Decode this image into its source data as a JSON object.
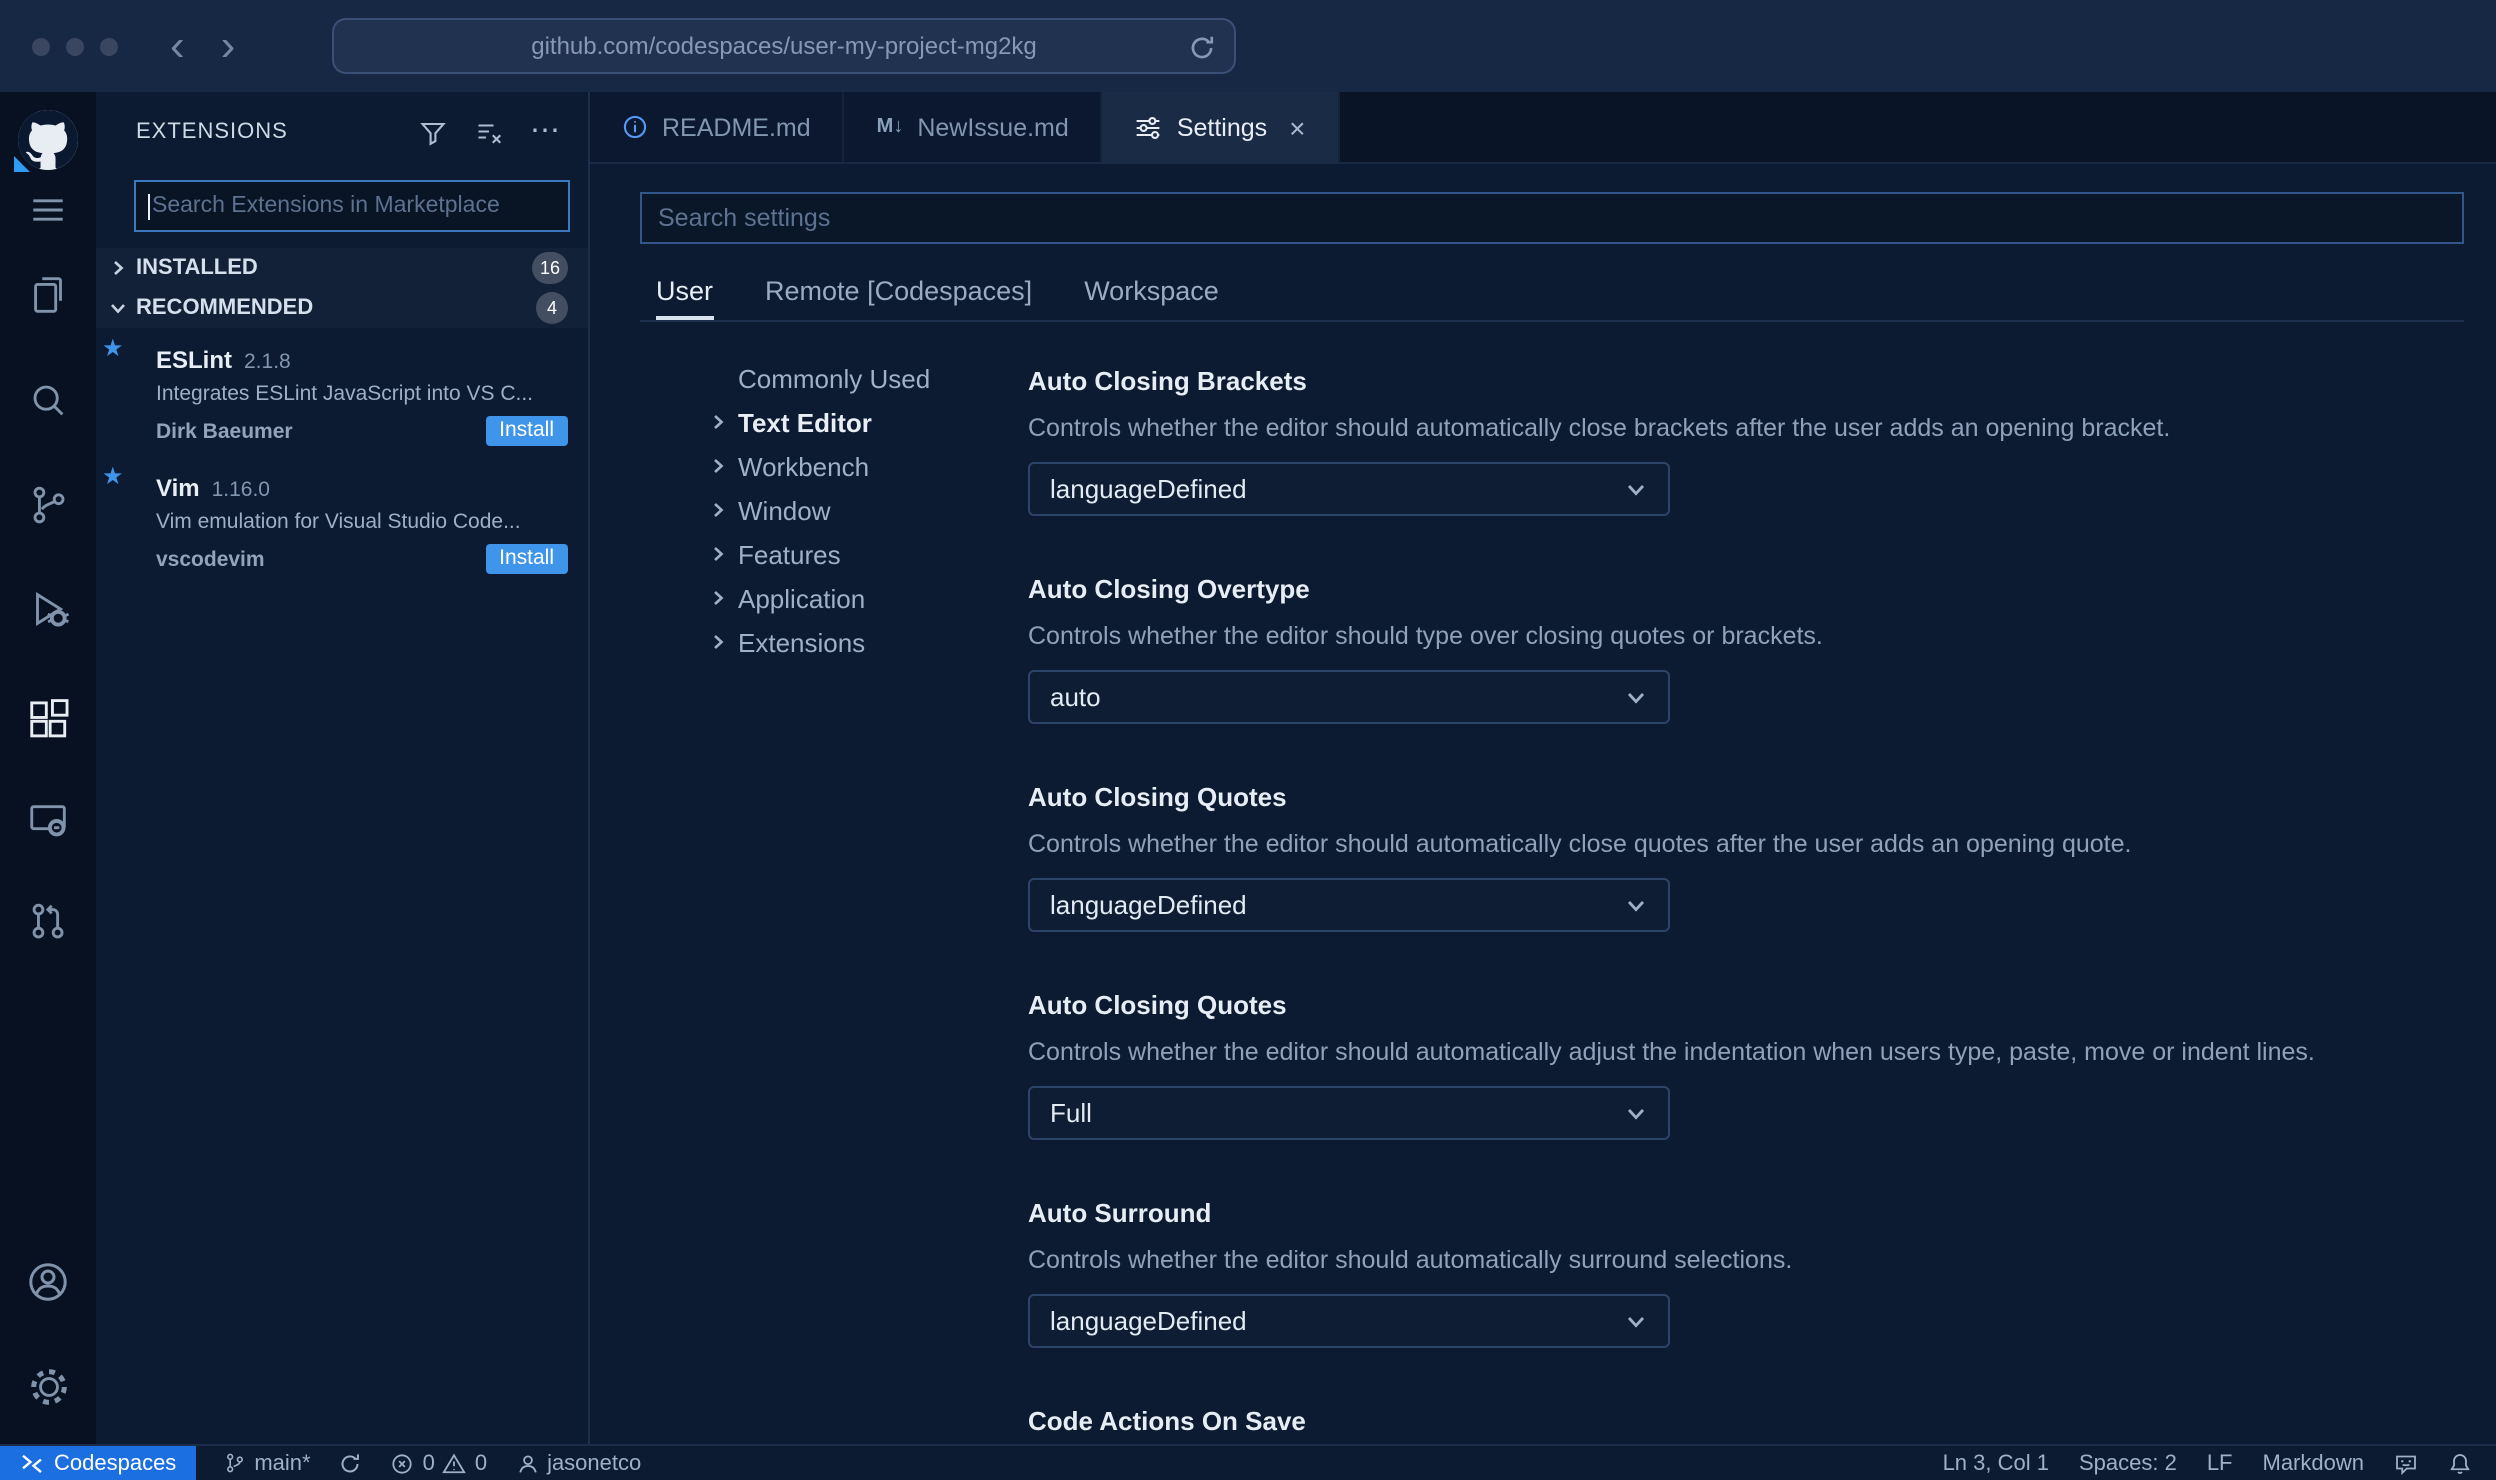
{
  "browser": {
    "url": "github.com/codespaces/user-my-project-mg2kg"
  },
  "glyphs": {
    "back": "‹",
    "forward": "›",
    "ellipsis": "⋯",
    "close": "×",
    "markdown_icon": "M↓",
    "star": "★"
  },
  "sidebar": {
    "title": "EXTENSIONS",
    "search_placeholder": "Search Extensions in Marketplace",
    "sections": [
      {
        "label": "INSTALLED",
        "count": "16"
      },
      {
        "label": "RECOMMENDED",
        "count": "4"
      }
    ],
    "extensions": [
      {
        "name": "ESLint",
        "version": "2.1.8",
        "description": "Integrates ESLint JavaScript into VS C...",
        "publisher": "Dirk Baeumer",
        "action": "Install"
      },
      {
        "name": "Vim",
        "version": "1.16.0",
        "description": "Vim emulation for Visual Studio Code...",
        "publisher": "vscodevim",
        "action": "Install"
      }
    ]
  },
  "editor": {
    "tabs": [
      {
        "label": "README.md"
      },
      {
        "label": "NewIssue.md"
      },
      {
        "label": "Settings"
      }
    ]
  },
  "settings": {
    "search_placeholder": "Search settings",
    "scopes": [
      "User",
      "Remote [Codespaces]",
      "Workspace"
    ],
    "toc": [
      "Commonly Used",
      "Text Editor",
      "Workbench",
      "Window",
      "Features",
      "Application",
      "Extensions"
    ],
    "items": [
      {
        "title": "Auto Closing Brackets",
        "description": "Controls whether the editor should automatically close brackets after the user adds an opening bracket.",
        "value": "languageDefined"
      },
      {
        "title": "Auto Closing Overtype",
        "description": "Controls whether the editor should type over closing quotes or brackets.",
        "value": "auto"
      },
      {
        "title": "Auto Closing Quotes",
        "description": "Controls whether the editor should automatically close quotes after the user adds an opening quote.",
        "value": "languageDefined"
      },
      {
        "title": "Auto Closing Quotes",
        "description": "Controls whether the editor should automatically adjust the indentation when users type, paste, move or indent lines.",
        "value": "Full"
      },
      {
        "title": "Auto Surround",
        "description": "Controls whether the editor should automatically surround selections.",
        "value": "languageDefined"
      },
      {
        "title": "Code Actions On Save"
      }
    ]
  },
  "status_bar": {
    "remote_label": "Codespaces",
    "branch": "main*",
    "errors": "0",
    "warnings": "0",
    "user": "jasonetco",
    "cursor": "Ln 3, Col 1",
    "indent": "Spaces: 2",
    "eol": "LF",
    "language": "Markdown"
  }
}
